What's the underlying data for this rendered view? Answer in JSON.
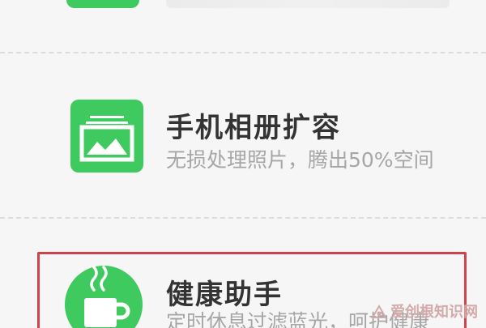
{
  "items": [
    {
      "title": "手机相册扩容",
      "subtitle": "无损处理照片，腾出50%空间",
      "icon": "photo-album-icon"
    },
    {
      "title": "健康助手",
      "subtitle": "定时休息过滤蓝光，呵护健康",
      "icon": "coffee-cup-icon"
    }
  ],
  "watermark": {
    "text": "爱创根知识网"
  },
  "colors": {
    "icon_green": "#3fca5f",
    "highlight_red": "#d0434c"
  }
}
